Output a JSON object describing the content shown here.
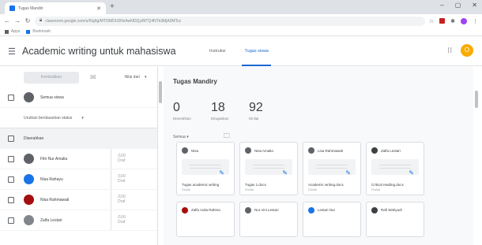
{
  "browser": {
    "tab_title": "Tugas Mandiri",
    "url": "classroom.google.com/u/0/g/tg/MTI3MDU0NzAwNDQy/MTQ4NTk3MjA2MTcz",
    "bookmarks": [
      "Apps",
      "Bookmark"
    ]
  },
  "header": {
    "title": "Academic writing untuk mahasiswa",
    "tabs": [
      "Instruksi",
      "Tugas siswa"
    ],
    "active_tab": "Tugas siswa",
    "user_initial": "O"
  },
  "left": {
    "return_button": "Kembalikan",
    "sort_label": "Nilai dari",
    "all_students_label": "Semua siswa",
    "sort_by": "Urutkan berdasarkan status",
    "group_label": "Diserahkan",
    "students": [
      {
        "name": "Fitri Nur Amalia",
        "grade": "/100",
        "status": "Draf"
      },
      {
        "name": "Nisa Rahayu",
        "grade": "/100",
        "status": "Draf"
      },
      {
        "name": "Nisa Rahmawati",
        "grade": "/100",
        "status": "Draf"
      },
      {
        "name": "Zalfa Lestari",
        "grade": "/100",
        "status": "Draf"
      }
    ]
  },
  "main": {
    "assignment_title": "Tugas Mandiry",
    "stats": [
      {
        "value": "0",
        "label": "Diserahkan"
      },
      {
        "value": "18",
        "label": "Ditugaskan"
      },
      {
        "value": "92",
        "label": "Dinilai"
      }
    ],
    "filter_label": "Semua",
    "cards": [
      {
        "student": "Nisa",
        "file": "Tugas academic writing",
        "status": "Dinilai",
        "color": "#5f6368"
      },
      {
        "student": "Nisa Amalia",
        "file": "Tugas 1.docx",
        "status": "Dinilai",
        "color": "#5f6368"
      },
      {
        "student": "Lisa Rahmawati",
        "file": "Academic writing.docx",
        "status": "Dinilai",
        "color": "#5f6368"
      },
      {
        "student": "Zalfa Lestari",
        "file": "Critical reading.docx",
        "status": "Dinilai",
        "color": "#3c4043"
      },
      {
        "student": "Zalfa Aulia Rahma",
        "color": "#a50e0e"
      },
      {
        "student": "Nur Aini Lestari",
        "color": "#5f6368"
      },
      {
        "student": "Lestari Nur",
        "color": "#1a73e8"
      },
      {
        "student": "Rafi Wahyudi",
        "color": "#3c4043"
      }
    ]
  }
}
